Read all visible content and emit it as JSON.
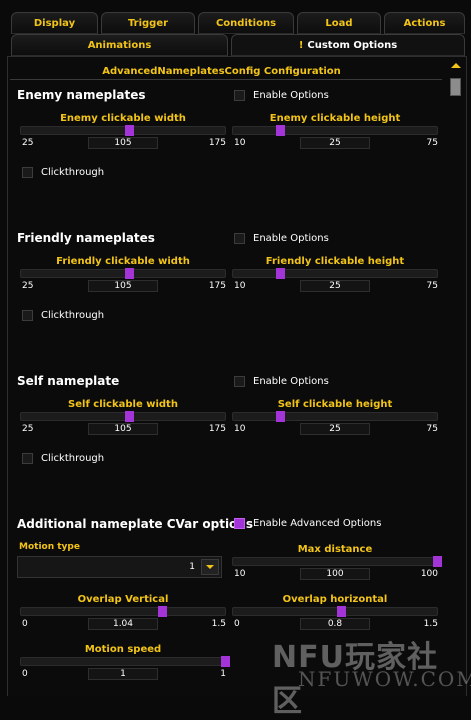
{
  "tabs_row1": [
    "Display",
    "Trigger",
    "Conditions",
    "Load",
    "Actions"
  ],
  "tabs_row2": [
    "Animations",
    "Custom Options"
  ],
  "active_tab": "Custom Options",
  "active_tab_marker": "!",
  "config_title": "AdvancedNameplatesConfig Configuration",
  "sections": [
    {
      "title": "Enemy nameplates",
      "enable_label": "Enable Options",
      "enable_checked": false,
      "width_slider": {
        "label": "Enemy clickable width",
        "min": "25",
        "max": "175",
        "value": "105",
        "fraction": 0.53
      },
      "height_slider": {
        "label": "Enemy clickable height",
        "min": "10",
        "max": "75",
        "value": "25",
        "fraction": 0.23
      },
      "clickthrough_label": "Clickthrough",
      "clickthrough_checked": false
    },
    {
      "title": "Friendly nameplates",
      "enable_label": "Enable Options",
      "enable_checked": false,
      "width_slider": {
        "label": "Friendly clickable width",
        "min": "25",
        "max": "175",
        "value": "105",
        "fraction": 0.53
      },
      "height_slider": {
        "label": "Friendly clickable height",
        "min": "10",
        "max": "75",
        "value": "25",
        "fraction": 0.23
      },
      "clickthrough_label": "Clickthrough",
      "clickthrough_checked": false
    },
    {
      "title": "Self nameplate",
      "enable_label": "Enable Options",
      "enable_checked": false,
      "width_slider": {
        "label": "Self clickable width",
        "min": "25",
        "max": "175",
        "value": "105",
        "fraction": 0.53
      },
      "height_slider": {
        "label": "Self clickable height",
        "min": "10",
        "max": "75",
        "value": "25",
        "fraction": 0.23
      },
      "clickthrough_label": "Clickthrough",
      "clickthrough_checked": false
    }
  ],
  "cvar": {
    "title": "Additional nameplate CVar options",
    "advanced_label": "Enable Advanced Options",
    "advanced_checked": true,
    "motion_type": {
      "label": "Motion type",
      "value": "1"
    },
    "max_distance": {
      "label": "Max distance",
      "min": "10",
      "max": "100",
      "value": "100",
      "fraction": 1.0
    },
    "overlap_vertical": {
      "label": "Overlap Vertical",
      "min": "0",
      "max": "1.5",
      "value": "1.04",
      "fraction": 0.69
    },
    "overlap_horizontal": {
      "label": "Overlap horizontal",
      "min": "0",
      "max": "1.5",
      "value": "0.8",
      "fraction": 0.53
    },
    "motion_speed": {
      "label": "Motion speed",
      "min": "0",
      "max": "1",
      "value": "1",
      "fraction": 1.0
    }
  },
  "watermark": {
    "top": "NFU玩家社区",
    "bottom": "NFUWOW.COM"
  },
  "colors": {
    "accent": "#f2c418",
    "checkbox_checked": "#a335d8",
    "background": "#0a0a0a"
  },
  "icons": {
    "scroll_up": "scroll-up-arrow-icon",
    "dropdown": "dropdown-arrow-icon",
    "tab_marker": "exclamation-icon"
  }
}
